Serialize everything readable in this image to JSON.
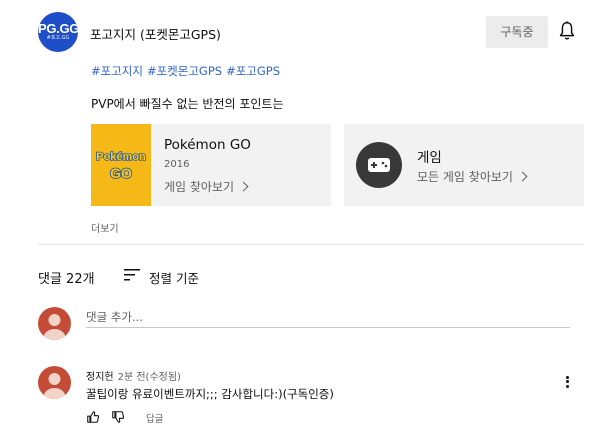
{
  "channel": {
    "logo_text": "PG.GG",
    "logo_subtext": "#포고.GG",
    "name": "포고지지 (포켓몬고GPS)",
    "subscribe_label": "구독중"
  },
  "hashtags": [
    "#포고지지",
    "#포켓몬고GPS",
    "#포고GPS"
  ],
  "description": "PVP에서 빠질수 없는 반전의 포인트는",
  "game_card": {
    "title": "Pokémon GO",
    "year": "2016",
    "link_label": "게임 찾아보기",
    "logo_top": "Pokémon",
    "logo_bottom": "GO"
  },
  "category_card": {
    "title": "게임",
    "link_label": "모든 게임 찾아보기",
    "icon": "gamepad-icon"
  },
  "more_label": "더보기",
  "comments": {
    "count_label": "댓글 22개",
    "sort_label": "정렬 기준",
    "add_placeholder": "댓글 추가...",
    "items": [
      {
        "author": "정지헌",
        "time": "2분 전(수정됨)",
        "text": "꿀팁이랑 유료이벤트까지;;; 감사합니다:)(구독인증)",
        "reply_label": "답글"
      }
    ]
  },
  "colors": {
    "hashtag": "#3066c9",
    "channel_avatar": "#1e4fc9",
    "user_avatar": "#c44c36",
    "game_thumb": "#f6b817"
  }
}
